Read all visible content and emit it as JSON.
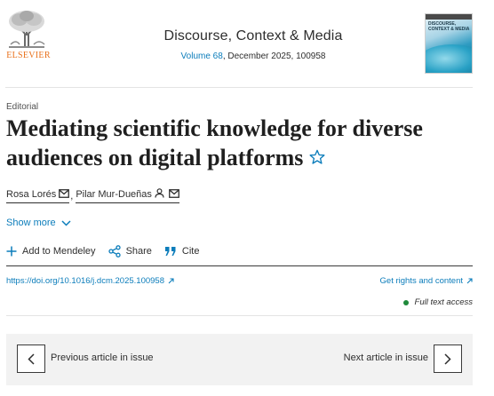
{
  "publisher": {
    "logo_text": "ELSEVIER",
    "logo_icon": "elsevier-tree-logo",
    "brand_color": "#e9711c"
  },
  "journal": {
    "name": "Discourse, Context & Media",
    "volume_link": "Volume 68",
    "issue_info": ", December 2025, 100958",
    "cover_title": "DISCOURSE, CONTEXT & MEDIA"
  },
  "article": {
    "type": "Editorial",
    "title": "Mediating scientific knowledge for diverse audiences on digital platforms",
    "authors": [
      {
        "name": "Rosa Lorés",
        "icons": [
          "mail-icon"
        ]
      },
      {
        "name": "Pilar Mur-Dueñas",
        "icons": [
          "person-icon",
          "mail-icon"
        ]
      }
    ],
    "author_separator": ",",
    "show_more": "Show more",
    "favorite_icon": "star-outline-icon"
  },
  "toolbar": {
    "add_to_mendeley": "Add to Mendeley",
    "share": "Share",
    "cite": "Cite"
  },
  "links": {
    "doi": "https://doi.org/10.1016/j.dcm.2025.100958",
    "rights": "Get rights and content"
  },
  "access": {
    "label": "Full text access",
    "status_color": "#1f8a3b"
  },
  "navigation": {
    "previous": "Previous article in issue",
    "next": "Next article in issue"
  },
  "colors": {
    "link": "#0c7dbb",
    "text": "#1f1f1f",
    "panel": "#f2f2f2"
  }
}
